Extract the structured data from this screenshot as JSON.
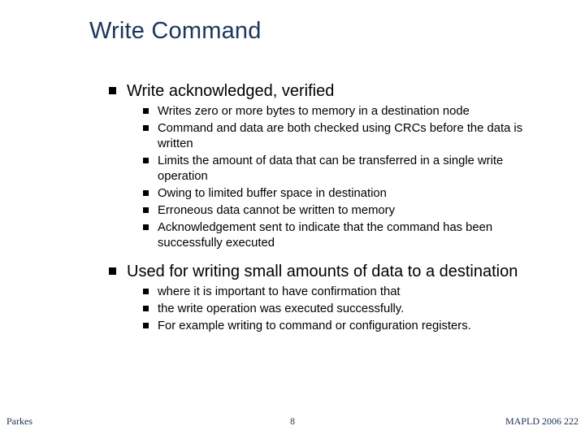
{
  "title": "Write Command",
  "bullets": {
    "b1": {
      "text": "Write acknowledged, verified",
      "sub": [
        "Writes zero or more bytes to memory in a destination node",
        "Command and data are both checked using CRCs before the data is written",
        "Limits the amount of data that can be transferred in a single write operation",
        "Owing to limited buffer space in destination",
        "Erroneous data cannot be written to memory",
        "Acknowledgement sent to indicate that the command has been successfully executed"
      ]
    },
    "b2": {
      "text": "Used for writing small amounts of data to a destination",
      "sub": [
        "where it is important to have confirmation that",
        "the write operation was executed successfully.",
        "For example writing to command or configuration registers."
      ]
    }
  },
  "footer": {
    "left": "Parkes",
    "center": "8",
    "right": "MAPLD 2006 222"
  }
}
